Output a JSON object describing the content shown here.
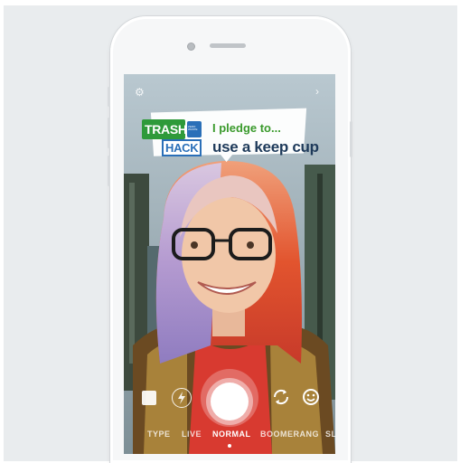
{
  "sticker": {
    "logo_line1": "TRASH",
    "logo_line2": "HACK",
    "logo_badge": "ZERO WASTE",
    "pledge_intro": "I pledge to...",
    "pledge_action": "use a keep cup"
  },
  "camera": {
    "top_left_icon": "settings-icon",
    "top_right_icon": "chevron-right-icon",
    "modes": [
      "TYPE",
      "LIVE",
      "NORMAL",
      "BOOMERANG",
      "SL"
    ],
    "active_mode": "NORMAL"
  },
  "colors": {
    "logo_green": "#2e9a3a",
    "logo_blue": "#2a6fb8",
    "pledge_green": "#3a9a2c",
    "pledge_navy": "#1e3a5a"
  }
}
